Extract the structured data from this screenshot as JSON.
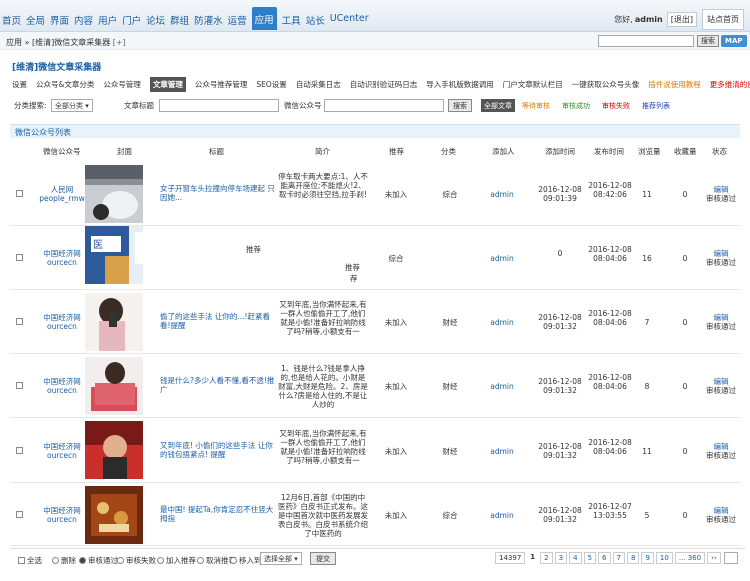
{
  "topnav": {
    "items": [
      "首页",
      "全局",
      "界面",
      "内容",
      "用户",
      "门户",
      "论坛",
      "群组",
      "防灌水",
      "运营",
      "应用",
      "工具",
      "站长",
      "UCenter"
    ],
    "active_index": 10
  },
  "user": {
    "greeting": "您好,",
    "name": "admin",
    "logout": "[退出]",
    "site_home": "站点首页"
  },
  "breadcrumb": {
    "root": "应用",
    "page": "[维清]微信文章采集器",
    "add": "[+]"
  },
  "top_search": {
    "button": "搜索",
    "map": "MAP"
  },
  "plugin_title": "[维清]微信文章采集器",
  "subtabs": [
    "设置",
    "公众号&文章分类",
    "公众号管理",
    "文章管理",
    "公众号推荐管理",
    "SEO设置",
    "自动采集日志",
    "自动识别验证码日志",
    "导入手机版数据调用",
    "门户文章默认栏目",
    "一键获取公众号头像",
    "插件说使用教程",
    "更多维清的应用"
  ],
  "subtab_active": 3,
  "filter": {
    "category_label": "分类搜索:",
    "category_value": "全部分类",
    "title_label": "文章标题",
    "account_label": "微信公众号",
    "search_btn": "搜索",
    "all_articles": "全部文章",
    "status_links": [
      {
        "label": "等待审核",
        "color": "#e07b00"
      },
      {
        "label": "审核成功",
        "color": "#2e8b2e"
      },
      {
        "label": "审核失败",
        "color": "#d00000"
      },
      {
        "label": "推荐列表",
        "color": "#2040c0"
      }
    ]
  },
  "list_title": "微信公众号列表",
  "columns": [
    "微信公众号",
    "封面",
    "标题",
    "简介",
    "推荐",
    "分类",
    "添加人",
    "添加时间",
    "发布时间",
    "浏览量",
    "收藏量",
    "状态"
  ],
  "rows": [
    {
      "account_name": "人民网",
      "account_id": "people_rmw",
      "title": "女子开窗车头拉撞向停车场建起 只因她...",
      "summary": "停车取卡两大要点:1、人不能离开座位;不能熄火!2、取卡时必须往空挡,拉手刹!",
      "recommend": "未加入",
      "category": "综合",
      "adder": "admin",
      "added_date": "2016-12-08",
      "added_time": "09:01:39",
      "pub_date": "2016-12-08",
      "pub_time": "08:42:06",
      "views": "11",
      "favs": "0",
      "edit": "编辑",
      "status": "审核通过",
      "thumb": "car"
    },
    {
      "account_name": "中国经济网",
      "account_id": "ourcecn",
      "title": "",
      "summary": "",
      "recommend": "综合",
      "category": "",
      "adder": "admin",
      "added_date": "0",
      "added_time": "",
      "pub_date": "2016-12-08",
      "pub_time": "08:04:06",
      "views": "16",
      "favs": "0",
      "edit": "编辑",
      "status": "审核通过",
      "thumb": "hospital"
    },
    {
      "account_name": "中国经济网",
      "account_id": "ourcecn",
      "title": "偷了的这些手法 让你的...!赶紧看看!提醒",
      "summary": "又到年底,当你满怀起来,有一群人也偷偷开工了,他们就是小偷!准备好拉响防线了吗?稍等,小额支有一",
      "recommend": "未加入",
      "category": "财经",
      "adder": "admin",
      "added_date": "2016-12-08",
      "added_time": "09:01:32",
      "pub_date": "2016-12-08",
      "pub_time": "08:04:06",
      "views": "7",
      "favs": "0",
      "edit": "编辑",
      "status": "审核通过",
      "thumb": "phone"
    },
    {
      "account_name": "中国经济网",
      "account_id": "ourcecn",
      "title": "钱是什么?多少人看不懂,看不透!推广",
      "summary": "1、钱是什么?钱是拿人挣的,也是给人花的。小财是财富,大财是危险。2、房是什么?房是给人住的,不是让人炒的",
      "recommend": "未加入",
      "category": "财经",
      "adder": "admin",
      "added_date": "2016-12-08",
      "added_time": "09:01:32",
      "pub_date": "2016-12-08",
      "pub_time": "08:04:06",
      "views": "8",
      "favs": "0",
      "edit": "编辑",
      "status": "审核通过",
      "thumb": "money"
    },
    {
      "account_name": "中国经济网",
      "account_id": "ourcecn",
      "title": "又到年底! 小偷们的这些手法 让你的钱包捂紧点! 提醒",
      "summary": "又到年底,当你满怀起来,有一群人也偷偷开工了,他们就是小偷!准备好拉响防线了吗?稍等,小额支有一",
      "recommend": "未加入",
      "category": "财经",
      "adder": "admin",
      "added_date": "2016-12-08",
      "added_time": "09:01:32",
      "pub_date": "2016-12-08",
      "pub_time": "08:04:06",
      "views": "11",
      "favs": "0",
      "edit": "编辑",
      "status": "审核通过",
      "thumb": "red"
    },
    {
      "account_name": "中国经济网",
      "account_id": "ourcecn",
      "title": "最中国! 提起Ta,你肯定忍不住竖大拇指",
      "summary": "12月6日,首部《中国的中医药》白皮书正式发布。这是中国首次就中医药发展发表白皮书。白皮书系统介绍了中医药的",
      "recommend": "未加入",
      "category": "综合",
      "adder": "admin",
      "added_date": "2016-12-08",
      "added_time": "09:01:32",
      "pub_date": "2016-12-07",
      "pub_time": "13:03:55",
      "views": "5",
      "favs": "0",
      "edit": "编辑",
      "status": "审核通过",
      "thumb": "medicine"
    }
  ],
  "overlays": {
    "recommend1": "推荐",
    "recommend2": "推荐"
  },
  "footer": {
    "select_all": "全选",
    "ops": [
      "删除",
      "审核通过",
      "审核失败",
      "加入推荐",
      "取消推荐",
      "移入到"
    ],
    "op_selected_index": 1,
    "move_select": "选择全部",
    "submit": "提交",
    "total": "14397",
    "pages": [
      "1",
      "2",
      "3",
      "4",
      "5",
      "6",
      "7",
      "8",
      "9",
      "10",
      "... 360",
      "››"
    ],
    "current_page": "1"
  }
}
